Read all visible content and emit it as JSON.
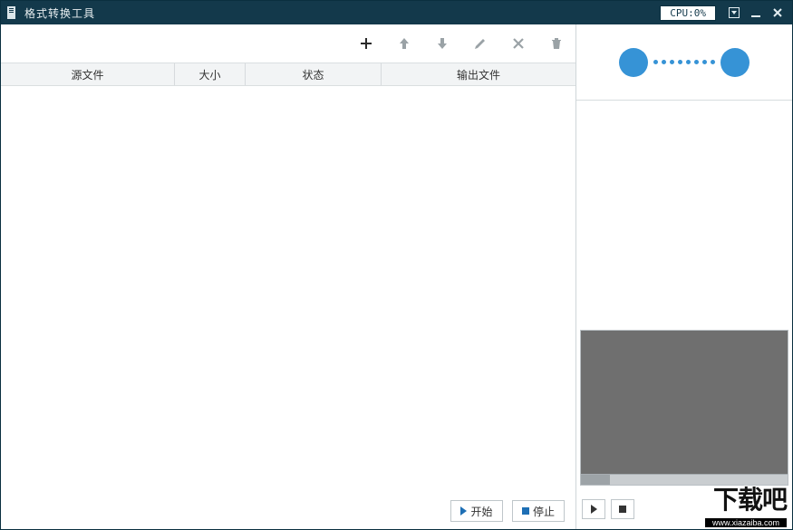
{
  "window": {
    "title": "格式转换工具",
    "cpu_label": "CPU:0%"
  },
  "toolbar": {
    "icons": {
      "add": "plus-icon",
      "up": "arrow-up-icon",
      "down": "arrow-down-icon",
      "edit": "pencil-icon",
      "remove": "x-icon",
      "delete": "trash-icon"
    }
  },
  "table": {
    "columns": [
      "源文件",
      "大小",
      "状态",
      "输出文件"
    ],
    "rows": []
  },
  "footer": {
    "start_label": "开始",
    "stop_label": "停止"
  },
  "preview": {
    "play_label": "play",
    "stop_label": "stop"
  },
  "watermark": {
    "text": "下载吧",
    "url": "www.xiazaiba.com"
  },
  "colors": {
    "titlebar": "#13394b",
    "accent": "#3693d6",
    "preview_bg": "#6f6f6f"
  }
}
